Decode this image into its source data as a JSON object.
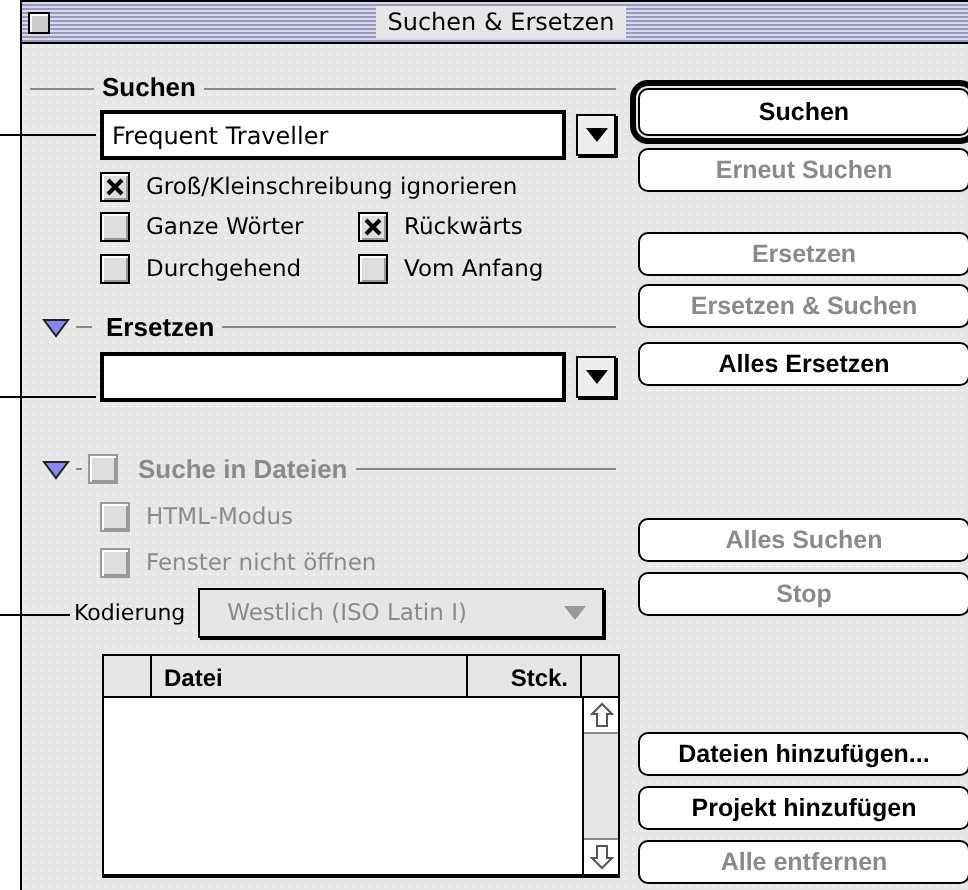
{
  "window": {
    "title": "Suchen & Ersetzen"
  },
  "search": {
    "heading": "Suchen",
    "value": "Frequent Traveller",
    "options": [
      {
        "label": "Groß/Kleinschreibung ignorieren",
        "checked": true
      },
      {
        "label": "Ganze Wörter",
        "checked": false
      },
      {
        "label": "Rückwärts",
        "checked": true
      },
      {
        "label": "Durchgehend",
        "checked": false
      },
      {
        "label": "Vom Anfang",
        "checked": false
      }
    ]
  },
  "replace": {
    "heading": "Ersetzen",
    "expanded": true
  },
  "file_search": {
    "heading": "Suche in Dateien",
    "expanded": true,
    "checked": false,
    "disabled": true,
    "options": [
      {
        "label": "HTML-Modus",
        "checked": false,
        "disabled": true
      },
      {
        "label": "Fenster nicht öffnen",
        "checked": false,
        "disabled": true
      }
    ],
    "encoding": {
      "label": "Kodierung",
      "value": "Westlich (ISO Latin I)",
      "disabled": true
    },
    "table": {
      "columns": [
        "Datei",
        "Stck."
      ]
    }
  },
  "buttons": [
    {
      "label": "Suchen",
      "default": true,
      "disabled": false
    },
    {
      "label": "Erneut Suchen",
      "default": false,
      "disabled": true
    },
    {
      "label": "Ersetzen",
      "default": false,
      "disabled": true
    },
    {
      "label": "Ersetzen & Suchen",
      "default": false,
      "disabled": true
    },
    {
      "label": "Alles Ersetzen",
      "default": false,
      "disabled": false
    },
    {
      "label": "Alles Suchen",
      "default": false,
      "disabled": true
    },
    {
      "label": "Stop",
      "default": false,
      "disabled": true
    },
    {
      "label": "Dateien hinzufügen...",
      "default": false,
      "disabled": false
    },
    {
      "label": "Projekt hinzufügen",
      "default": false,
      "disabled": false
    },
    {
      "label": "Alle entfernen",
      "default": false,
      "disabled": true
    }
  ]
}
